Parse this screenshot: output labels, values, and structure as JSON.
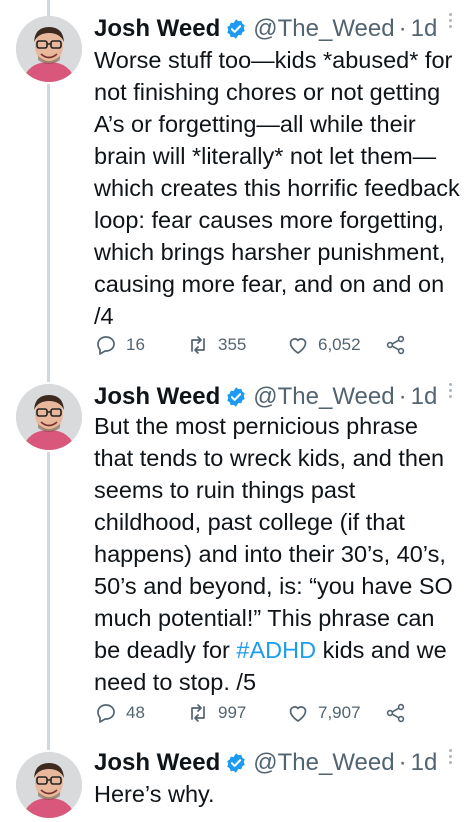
{
  "tweets": [
    {
      "name": "Josh Weed",
      "handle": "@The_Weed",
      "dot": "·",
      "time": "1d",
      "text": "Worse stuff too—kids *abused* for not finishing chores or not getting A’s or forgetting—all while their brain will *literally* not let them—which creates this horrific feedback loop: fear causes more forgetting, which brings harsher punishment, causing more fear, and on and on /4",
      "replies": "16",
      "retweets": "355",
      "likes": "6,052"
    },
    {
      "name": "Josh Weed",
      "handle": "@The_Weed",
      "dot": "·",
      "time": "1d",
      "text_before": "But the most pernicious phrase that tends to wreck kids, and then seems to ruin things past childhood, past college (if that happens) and into their 30’s, 40’s, 50’s and beyond, is: “you have SO much potential!” This phrase can be deadly for ",
      "hashtag": "#ADHD",
      "text_after": " kids and we need to stop. /5",
      "replies": "48",
      "retweets": "997",
      "likes": "7,907"
    },
    {
      "name": "Josh Weed",
      "handle": "@The_Weed",
      "dot": "·",
      "time": "1d",
      "text": "Here’s why."
    }
  ],
  "colors": {
    "verified": "#1d9bf0",
    "hashtag": "#1d9bf0",
    "muted": "#536471",
    "thread_line": "#cfd9de"
  },
  "icons": [
    "verified-badge-icon",
    "more-icon",
    "reply-icon",
    "retweet-icon",
    "like-icon",
    "share-icon"
  ]
}
